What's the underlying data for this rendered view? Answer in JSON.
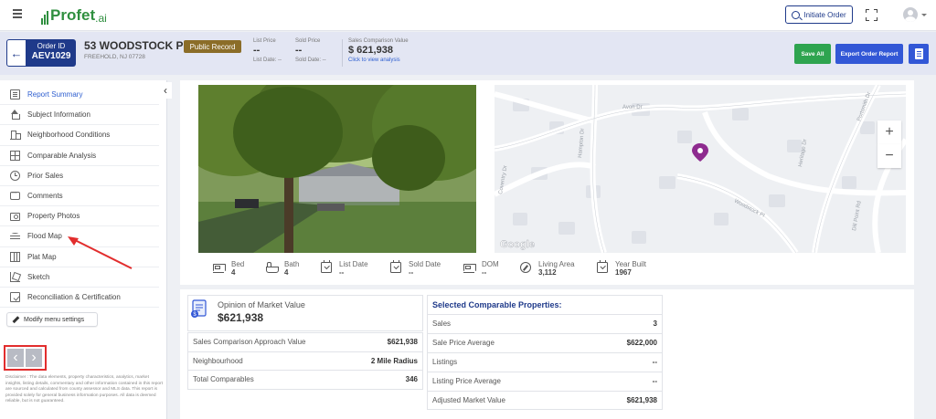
{
  "app": {
    "logo_text": "Profet",
    "logo_suffix": ".ai"
  },
  "topbar": {
    "initiate_label": "Initiate Order"
  },
  "order": {
    "id_label": "Order ID",
    "id_value": "AEV1029",
    "address": "53 WOODSTOCK PL",
    "city": "FREEHOLD, NJ 07728",
    "badge": "Public Record",
    "list_price_label": "List Price",
    "list_price_value": "--",
    "list_date_label": "List Date: --",
    "sold_price_label": "Sold Price",
    "sold_price_value": "--",
    "sold_date_label": "Sold Date: --",
    "scp_label": "Sales Comparison Value",
    "scp_value": "$ 621,938",
    "scp_link": "Click to view analysis",
    "save_label": "Save All",
    "export_label": "Export Order Report"
  },
  "sidebar": {
    "items": [
      {
        "label": "Report Summary",
        "icon": "report-icon",
        "active": true
      },
      {
        "label": "Subject Information",
        "icon": "house-icon"
      },
      {
        "label": "Neighborhood Conditions",
        "icon": "buildings-icon"
      },
      {
        "label": "Comparable Analysis",
        "icon": "table-icon"
      },
      {
        "label": "Prior Sales",
        "icon": "history-icon"
      },
      {
        "label": "Comments",
        "icon": "comment-icon"
      },
      {
        "label": "Property Photos",
        "icon": "photo-icon"
      },
      {
        "label": "Flood Map",
        "icon": "flood-icon"
      },
      {
        "label": "Plat Map",
        "icon": "map-icon"
      },
      {
        "label": "Sketch",
        "icon": "sketch-icon"
      },
      {
        "label": "Reconciliation & Certification",
        "icon": "certificate-icon"
      }
    ],
    "modify_label": "Modify menu settings",
    "disclaimer": "Disclaimer : The data elements, property characteristics, analytics, market insights, listing details, commentary and other information contained in this report are sourced and calculated from county assessor and MLS data. This report is provided solely for general business information purposes. All data is deemed reliable, but is not guaranteed."
  },
  "map": {
    "streets": [
      "Avon Dr",
      "Hampton Dr",
      "Woodstock Pl",
      "Coventry Dr",
      "Heritage Dr",
      "Portsmith Dr",
      "Dill Point Rd"
    ],
    "watermark": "Google",
    "zoom_in": "+",
    "zoom_out": "−"
  },
  "stats": [
    {
      "label": "Bed",
      "value": "4",
      "icon": "bed-icon"
    },
    {
      "label": "Bath",
      "value": "4",
      "icon": "bath-icon"
    },
    {
      "label": "List Date",
      "value": "--",
      "icon": "calendar-icon"
    },
    {
      "label": "Sold Date",
      "value": "--",
      "icon": "calendar-icon"
    },
    {
      "label": "DOM",
      "value": "--",
      "icon": "bed-icon"
    },
    {
      "label": "Living Area",
      "value": "3,112",
      "icon": "compass-icon"
    },
    {
      "label": "Year Built",
      "value": "1967",
      "icon": "calendar-icon"
    }
  ],
  "valuation": {
    "omv_label": "Opinion of Market Value",
    "omv_value": "$621,938",
    "rows": [
      {
        "label": "Sales Comparison Approach Value",
        "value": "$621,938"
      },
      {
        "label": "Neighbourhood",
        "value": "2 Mile Radius"
      },
      {
        "label": "Total Comparables",
        "value": "346"
      }
    ]
  },
  "comparables": {
    "title": "Selected Comparable Properties:",
    "rows": [
      {
        "label": "Sales",
        "value": "3"
      },
      {
        "label": "Sale Price Average",
        "value": "$622,000"
      },
      {
        "label": "Listings",
        "value": "--"
      },
      {
        "label": "Listing Price Average",
        "value": "--"
      },
      {
        "label": "Adjusted Market Value",
        "value": "$621,938"
      }
    ]
  }
}
